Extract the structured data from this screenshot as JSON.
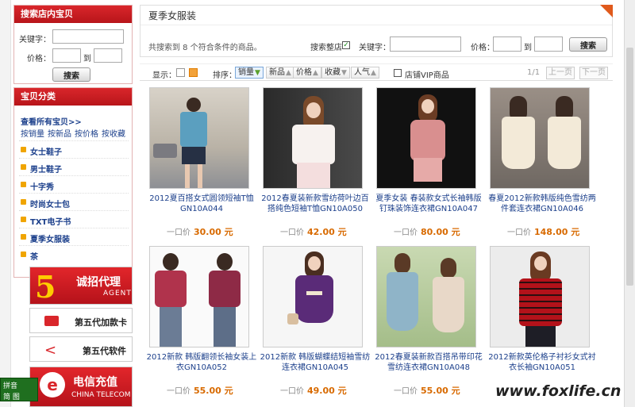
{
  "sidebar": {
    "search": {
      "title": "搜索店内宝贝",
      "keyword_label": "关键字：",
      "price_label": "价格：",
      "to_label": "到",
      "button": "搜索"
    },
    "categories": {
      "title": "宝贝分类",
      "all_link": "查看所有宝贝>>",
      "sort_links": [
        "按销量",
        "按新品",
        "按价格",
        "按收藏"
      ],
      "items": [
        "女士鞋子",
        "男士鞋子",
        "十字秀",
        "时尚女士包",
        "TXT电子书",
        "夏季女服装",
        "茶"
      ]
    },
    "promos": {
      "agent_title": "诚招代理",
      "agent_sub": "AGENT",
      "card": "第五代加款卡",
      "soft": "第五代软件",
      "telecom_title": "电信充值",
      "telecom_sub": "CHINA TELECOM"
    },
    "ime": {
      "line1": "拼音",
      "line2": "简 图"
    }
  },
  "main": {
    "page_title": "夏季女服装",
    "result_text": "共搜索到 8 个符合条件的商品。",
    "filter": {
      "shop_search_label": "搜索整店",
      "shop_search_checked": true,
      "keyword_label": "关键字：",
      "price_label": "价格：",
      "to_label": "到",
      "button": "搜索"
    },
    "toolbar": {
      "display_label": "显示：",
      "sort_label": "排序：",
      "sort_options": [
        "销量",
        "新品",
        "价格",
        "收藏",
        "人气"
      ],
      "active_sort": "销量",
      "vip_label": "店铺VIP商品",
      "page_indicator": "1/1",
      "prev": "上一页",
      "next": "下一页"
    },
    "price_label": "一口价",
    "products": [
      {
        "name": "2012夏百搭女式圆领短袖T恤GN10A044",
        "price": "30.00 元"
      },
      {
        "name": "2012春夏装新款雪纺荷叶边百搭纯色短袖T恤GN10A050",
        "price": "42.00 元"
      },
      {
        "name": "夏季女装 春装款女式长袖韩版钉珠装饰连衣裙GN10A047",
        "price": "80.00 元"
      },
      {
        "name": "春夏2012新款韩版纯色雪纺两件套连衣裙GN10A046",
        "price": "148.00 元"
      },
      {
        "name": "2012新款 韩版翻领长袖女装上衣GN10A052",
        "price": "55.00 元"
      },
      {
        "name": "2012新款 韩版蝴蝶结短袖雪纺连衣裙GN10A045",
        "price": "49.00 元"
      },
      {
        "name": "2012春夏装新款百搭吊带印花雪纺连衣裙GN10A048",
        "price": "55.00 元"
      },
      {
        "name": "2012新款英伦格子衬衫女式衬衣长袖GN10A051",
        "price": ""
      }
    ]
  },
  "watermark": "www.foxlife.cn",
  "colors": {
    "brand_red": "#d9262b",
    "link_blue": "#1b3f8b",
    "price_orange": "#d86a00"
  }
}
